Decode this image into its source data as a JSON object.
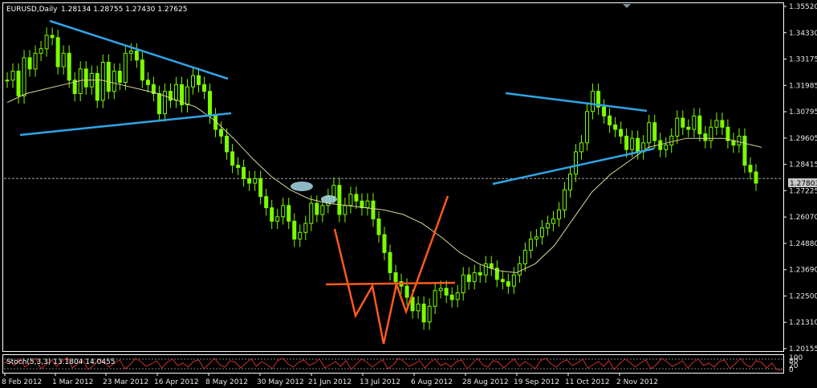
{
  "header": {
    "symbol": "EURUSD,Daily",
    "ohlc": "1.28134 1.28755 1.27430 1.27625"
  },
  "price_badge": "1.27803",
  "stoch_header": "Stoch(5,3,3) 13.1804 14.0455",
  "stoch_scale": [
    "100",
    "80",
    "20",
    "0"
  ],
  "colors": {
    "background": "#000000",
    "frame": "#ffffff",
    "grid": "#404040",
    "candle": "#7cfc00",
    "ma": "#d8d89a",
    "trend": "#2fa6e8",
    "pattern": "#ff5a1a",
    "stoch": "#c83030",
    "price_line": "#a0a0a0"
  },
  "chart_data": {
    "type": "line",
    "yaxis_ticks": [
      "1.35520",
      "1.34330",
      "1.33175",
      "1.31985",
      "1.30795",
      "1.29605",
      "1.28415",
      "1.27225",
      "1.26070",
      "1.24880",
      "1.23690",
      "1.22500",
      "1.21310",
      "1.20155"
    ],
    "xaxis_ticks": [
      "8 Feb 2012",
      "1 Mar 2012",
      "23 Mar 2012",
      "16 Apr 2012",
      "8 May 2012",
      "30 May 2012",
      "21 Jun 2012",
      "13 Jul 2012",
      "6 Aug 2012",
      "28 Aug 2012",
      "19 Sep 2012",
      "11 Oct 2012",
      "2 Nov 2012"
    ],
    "ylim": [
      1.201,
      1.356
    ],
    "current_price": 1.27803,
    "series": [
      {
        "values": [
          1.322,
          1.326,
          1.315,
          1.332,
          1.327,
          1.334,
          1.336,
          1.342,
          1.341,
          1.328,
          1.334,
          1.322,
          1.316,
          1.327,
          1.319,
          1.325,
          1.313,
          1.33,
          1.317,
          1.326,
          1.321,
          1.334,
          1.335,
          1.331,
          1.322,
          1.32,
          1.316,
          1.307,
          1.317,
          1.313,
          1.32,
          1.311,
          1.319,
          1.324,
          1.32,
          1.317,
          1.306,
          1.3,
          1.297,
          1.29,
          1.284,
          1.283,
          1.278,
          1.276,
          1.278,
          1.27,
          1.265,
          1.259,
          1.261,
          1.266,
          1.259,
          1.251,
          1.254,
          1.258,
          1.267,
          1.262,
          1.266,
          1.27,
          1.275,
          1.262,
          1.266,
          1.271,
          1.268,
          1.265,
          1.268,
          1.26,
          1.253,
          1.245,
          1.236,
          1.232,
          1.23,
          1.225,
          1.219,
          1.222,
          1.214,
          1.221,
          1.228,
          1.229,
          1.226,
          1.224,
          1.227,
          1.235,
          1.232,
          1.236,
          1.235,
          1.24,
          1.238,
          1.233,
          1.232,
          1.23,
          1.235,
          1.24,
          1.246,
          1.251,
          1.252,
          1.256,
          1.258,
          1.26,
          1.264,
          1.273,
          1.28,
          1.29,
          1.294,
          1.308,
          1.317,
          1.31,
          1.306,
          1.302,
          1.3,
          1.297,
          1.291,
          1.296,
          1.29,
          1.294,
          1.303,
          1.295,
          1.291,
          1.293,
          1.297,
          1.305,
          1.301,
          1.3,
          1.306,
          1.298,
          1.295,
          1.301,
          1.304,
          1.301,
          1.295,
          1.293,
          1.297,
          1.284,
          1.281,
          1.276
        ]
      },
      {
        "values": [
          1.312,
          1.316,
          1.318,
          1.32,
          1.322,
          1.322,
          1.32,
          1.318,
          1.316,
          1.313,
          1.31,
          1.304,
          1.296,
          1.287,
          1.279,
          1.273,
          1.269,
          1.267,
          1.266,
          1.265,
          1.264,
          1.262,
          1.258,
          1.252,
          1.245,
          1.24,
          1.237,
          1.236,
          1.24,
          1.248,
          1.26,
          1.272,
          1.28,
          1.286,
          1.292,
          1.294,
          1.296,
          1.296,
          1.296,
          1.294,
          1.292
        ]
      }
    ],
    "stoch": [
      55,
      70,
      40,
      80,
      30,
      60,
      85,
      20,
      45,
      75,
      35,
      65,
      90,
      25,
      50,
      70,
      15,
      40,
      80,
      60,
      30,
      55,
      75,
      20,
      45,
      85,
      65,
      35,
      50,
      70,
      25,
      60,
      80,
      40,
      55,
      30,
      65,
      75,
      20,
      50,
      85,
      45,
      30,
      70,
      60,
      25,
      55,
      80,
      35,
      65,
      45,
      20,
      70,
      85,
      50,
      30,
      60,
      75,
      40,
      55,
      80,
      25,
      45,
      65,
      35,
      70,
      15,
      50,
      80,
      60,
      30,
      55,
      75,
      20,
      45,
      85,
      65,
      35,
      50,
      70,
      25,
      60,
      80,
      40,
      55,
      30,
      65,
      75,
      20,
      50,
      85,
      45,
      30,
      70,
      60,
      25,
      55,
      80,
      35,
      65,
      45,
      20,
      70,
      85,
      50,
      30,
      60,
      75,
      40,
      55,
      80,
      25,
      45,
      65,
      35,
      70,
      15,
      50,
      80,
      60,
      30,
      55,
      75,
      20,
      45,
      85,
      65,
      35,
      50,
      70,
      25,
      60,
      80,
      40,
      55,
      30,
      65,
      75,
      20,
      50,
      85,
      45,
      30,
      70,
      60,
      25,
      55,
      14,
      13
    ]
  }
}
